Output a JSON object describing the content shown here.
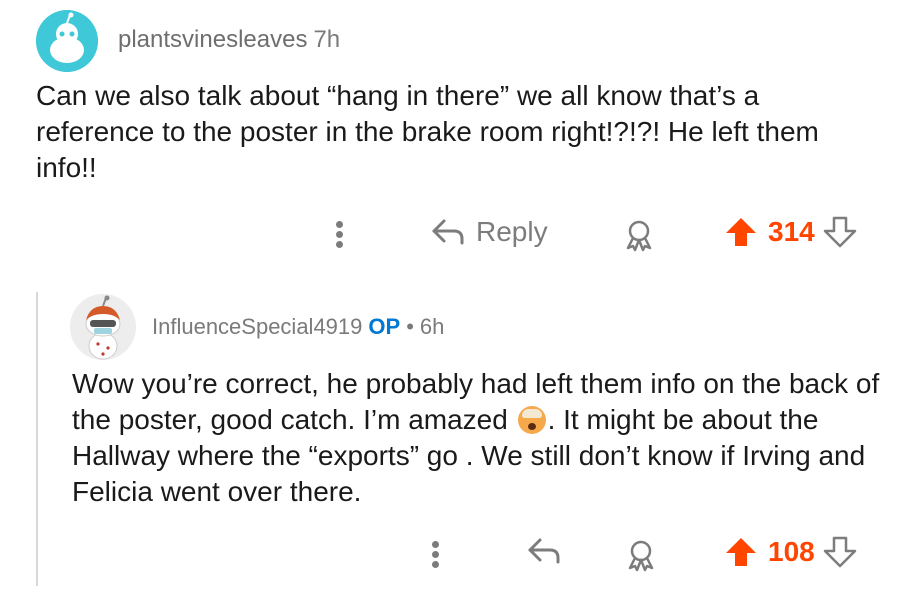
{
  "top_comment": {
    "username": "plantsvinesleaves",
    "time": "7h",
    "text": "Can we also talk about “hang in there” we all know that’s a reference to the poster in the brake room right!?!?! He left them info!!",
    "actions": {
      "reply_label": "Reply",
      "score": "314"
    }
  },
  "reply_comment": {
    "username": "InfluenceSpecial4919",
    "op_badge": "OP",
    "separator": "•",
    "time": "6h",
    "text_part1": "Wow you’re correct, he probably had left them info on the back of the poster, good catch. I’m amazed ",
    "text_part2": ". It might be about the Hallway where the “exports” go . We still don’t know if Irving  and Felicia went over there.",
    "actions": {
      "score": "108"
    }
  },
  "colors": {
    "upvote_active": "#ff4500",
    "op_badge": "#0079d3",
    "avatar_top_bg": "#3fc8d8",
    "muted_text": "#7c7c7c"
  },
  "icons": {
    "more": "more-vertical-icon",
    "reply": "reply-arrow-icon",
    "award": "award-icon",
    "upvote": "upvote-arrow-icon",
    "downvote": "downvote-arrow-icon",
    "emoji": "exploding-head-emoji"
  }
}
